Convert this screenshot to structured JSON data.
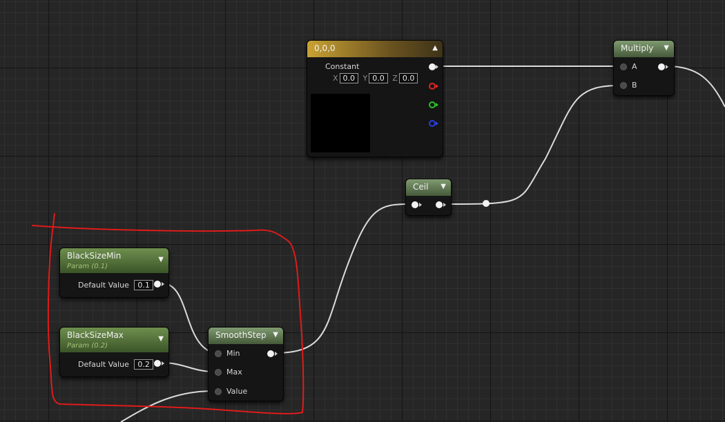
{
  "constant_node": {
    "title": "0,0,0",
    "label": "Constant",
    "x": {
      "axis": "X",
      "value": "0.0"
    },
    "y": {
      "axis": "Y",
      "value": "0.0"
    },
    "z": {
      "axis": "Z",
      "value": "0.0"
    },
    "preview_color": "#000000"
  },
  "multiply_node": {
    "title": "Multiply",
    "input_a": "A",
    "input_b": "B"
  },
  "ceil_node": {
    "title": "Ceil"
  },
  "param_min": {
    "title": "BlackSizeMin",
    "subtitle": "Param (0.1)",
    "field_label": "Default Value",
    "value": "0.1"
  },
  "param_max": {
    "title": "BlackSizeMax",
    "subtitle": "Param (0.2)",
    "field_label": "Default Value",
    "value": "0.2"
  },
  "smoothstep_node": {
    "title": "SmoothStep",
    "input_min": "Min",
    "input_max": "Max",
    "input_value": "Value"
  },
  "colors": {
    "node_header": "#5e7a4c",
    "param_header": "#567a36",
    "constant_header": "#c9a233",
    "wire": "#e6e6e6",
    "annotation": "#e01b1b"
  }
}
